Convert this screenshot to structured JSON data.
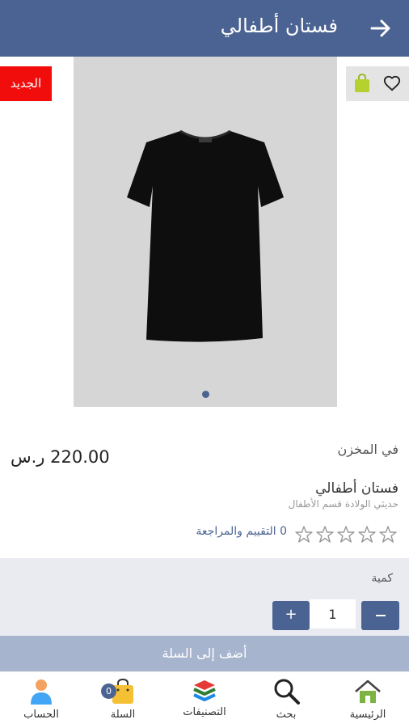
{
  "header": {
    "title": "فستان أطفالي",
    "back_icon": "arrow-right-icon"
  },
  "product": {
    "badge": "الجديد",
    "stock": "في المخزن",
    "price": "220.00 ر.س",
    "name": "فستان أطفالي",
    "category": "حديثي الولادة قسم الأطفال",
    "rating_text": "0 التقييم والمراجعة",
    "rating": 0,
    "rating_max": 5,
    "image_count": 1,
    "current_image": 1
  },
  "quantity": {
    "label": "كمية",
    "value": "1",
    "plus_label": "+",
    "minus_icon": "minus-icon"
  },
  "add_to_cart": {
    "label": "أضف إلى السلة"
  },
  "nav": {
    "items": [
      {
        "label": "الرئيسية",
        "icon": "home-icon"
      },
      {
        "label": "بحث",
        "icon": "search-icon"
      },
      {
        "label": "التصنيفات",
        "icon": "layers-icon"
      },
      {
        "label": "السلة",
        "icon": "shopping-bag-icon",
        "badge": "0"
      },
      {
        "label": "الحساب",
        "icon": "user-icon"
      }
    ]
  },
  "colors": {
    "primary": "#4b6392",
    "badge_red": "#f20d0d",
    "cart_button": "#a7b4cd",
    "home_green": "#7cb342"
  }
}
